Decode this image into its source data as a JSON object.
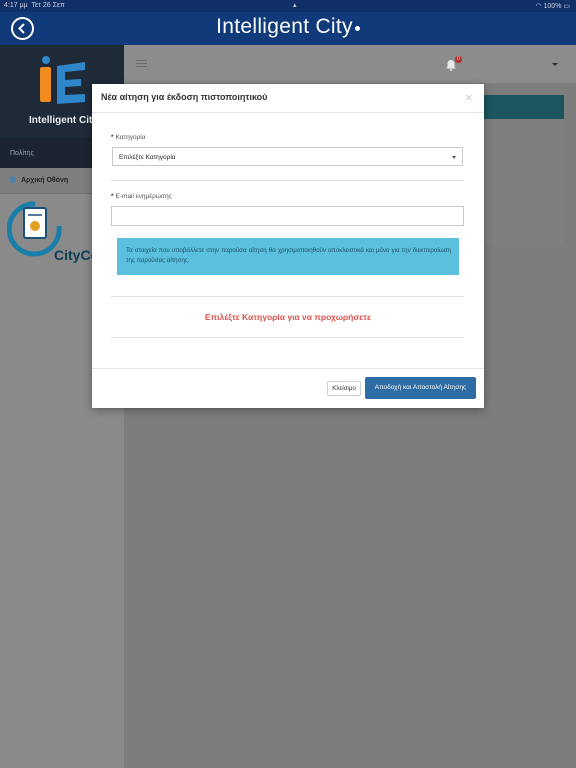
{
  "status_bar": {
    "time": "4:17 μμ",
    "date": "Τετ 26 Σεπ",
    "battery": "100%"
  },
  "app": {
    "title": "Intelligent City"
  },
  "sidebar": {
    "brand_name": "Intelligent City",
    "section_label": "Πολίτης",
    "menu_items": [
      {
        "label": "Αρχική Οθόνη",
        "icon": "globe-icon"
      }
    ],
    "citycert_text": "CityCe"
  },
  "topbar": {
    "notification_count": "0"
  },
  "modal": {
    "title": "Νέα αίτηση για έκδοση πιστοποιητικού",
    "close_symbol": "×",
    "category": {
      "required_mark": "*",
      "label": "Κατηγορία",
      "selected": "Επιλέξτε Κατηγορία"
    },
    "email": {
      "required_mark": "*",
      "label": "E-mail ενημέρωσης",
      "value": ""
    },
    "info_text": "Τα στοιχεία που υποβάλλετε στην παρούσα αίτηση θα χρησιμοποιηθούν αποκλειστικά και μόνο για την διεκπεραίωση της παρούσας αίτησης.",
    "warning_text": "Επιλέξτε Κατηγορία για να προχωρήσετε",
    "buttons": {
      "close": "Κλείσιμο",
      "submit": "Αποδοχή και Αποστολή Αίτησης"
    }
  },
  "colors": {
    "header": "#103a7a",
    "info_bg": "#5bc0de",
    "warning": "#d9534f",
    "primary_button": "#2e6da4"
  }
}
